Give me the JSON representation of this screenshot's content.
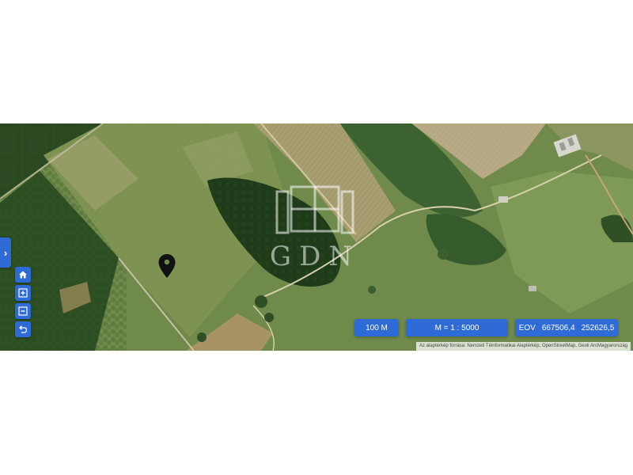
{
  "map": {
    "watermark_text": "GDN",
    "marker_icon": "map-pin-icon"
  },
  "controls": {
    "panel_toggle_icon": "chevron-right-icon",
    "home_icon": "home-icon",
    "zoom_in_icon": "zoom-in-icon",
    "zoom_out_icon": "zoom-out-icon",
    "back_icon": "undo-arrow-icon"
  },
  "scale_bar": {
    "label": "100 M"
  },
  "map_scale": {
    "label": "M = 1 : 5000"
  },
  "coordinates": {
    "system": "EOV",
    "x": "667506,4",
    "y": "252626,5"
  },
  "attribution": "Az alaptérkép forrása: Nemzeti Téinformatikai Alaptérkép, OpenStreetMap, Geoli ArcMagyarország",
  "colors": {
    "accent": "#2f6bd6",
    "background": "#ffffff"
  }
}
